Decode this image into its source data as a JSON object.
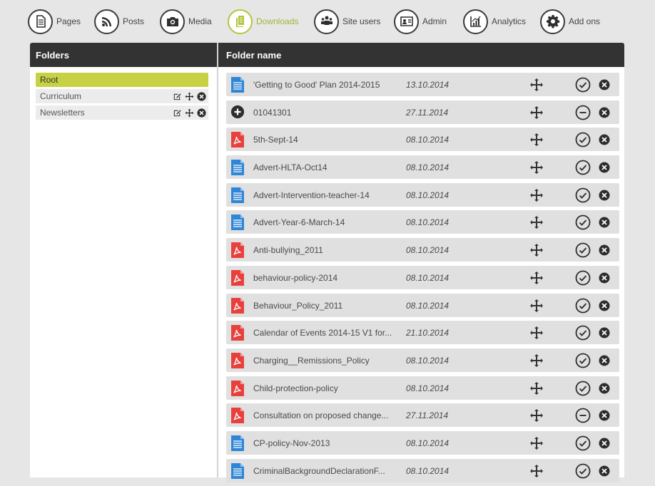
{
  "nav": {
    "items": [
      {
        "label": "Pages",
        "icon": "pages-icon",
        "active": false
      },
      {
        "label": "Posts",
        "icon": "rss-icon",
        "active": false
      },
      {
        "label": "Media",
        "icon": "camera-icon",
        "active": false
      },
      {
        "label": "Downloads",
        "icon": "documents-icon",
        "active": true
      },
      {
        "label": "Site users",
        "icon": "users-icon",
        "active": false
      },
      {
        "label": "Admin",
        "icon": "id-card-icon",
        "active": false
      },
      {
        "label": "Analytics",
        "icon": "chart-icon",
        "active": false
      },
      {
        "label": "Add ons",
        "icon": "gear-icon",
        "active": false
      }
    ]
  },
  "panel": {
    "folders_heading": "Folders",
    "files_heading": "Folder name"
  },
  "folders": [
    {
      "label": "Root",
      "selected": true
    },
    {
      "label": "Curriculum",
      "selected": false
    },
    {
      "label": "Newsletters",
      "selected": false
    }
  ],
  "files": [
    {
      "name": "'Getting to Good' Plan 2014-2015",
      "date": "13.10.2014",
      "type": "doc",
      "status": "published"
    },
    {
      "name": "01041301",
      "date": "27.11.2014",
      "type": "add",
      "status": "unpublished"
    },
    {
      "name": "5th-Sept-14",
      "date": "08.10.2014",
      "type": "pdf",
      "status": "published"
    },
    {
      "name": "Advert-HLTA-Oct14",
      "date": "08.10.2014",
      "type": "doc",
      "status": "published"
    },
    {
      "name": "Advert-Intervention-teacher-14",
      "date": "08.10.2014",
      "type": "doc",
      "status": "published"
    },
    {
      "name": "Advert-Year-6-March-14",
      "date": "08.10.2014",
      "type": "doc",
      "status": "published"
    },
    {
      "name": "Anti-bullying_2011",
      "date": "08.10.2014",
      "type": "pdf",
      "status": "published"
    },
    {
      "name": "behaviour-policy-2014",
      "date": "08.10.2014",
      "type": "pdf",
      "status": "published"
    },
    {
      "name": "Behaviour_Policy_2011",
      "date": "08.10.2014",
      "type": "pdf",
      "status": "published"
    },
    {
      "name": "Calendar of Events 2014-15 V1 for...",
      "date": "21.10.2014",
      "type": "pdf",
      "status": "published"
    },
    {
      "name": "Charging__Remissions_Policy",
      "date": "08.10.2014",
      "type": "pdf",
      "status": "published"
    },
    {
      "name": "Child-protection-policy",
      "date": "08.10.2014",
      "type": "pdf",
      "status": "published"
    },
    {
      "name": "Consultation on proposed change...",
      "date": "27.11.2014",
      "type": "pdf",
      "status": "unpublished"
    },
    {
      "name": "CP-policy-Nov-2013",
      "date": "08.10.2014",
      "type": "doc",
      "status": "published"
    },
    {
      "name": "CriminalBackgroundDeclarationF...",
      "date": "08.10.2014",
      "type": "doc",
      "status": "published"
    }
  ],
  "colors": {
    "accent": "#c6d144",
    "header_bg": "#333333",
    "pdf_red": "#e8413d",
    "doc_blue": "#2f86d6"
  }
}
